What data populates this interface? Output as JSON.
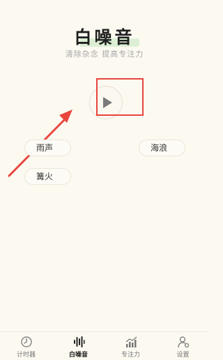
{
  "header": {
    "title": "白噪音",
    "subtitle": "清除杂念 提高专注力"
  },
  "player": {
    "play_icon": "play-icon"
  },
  "sounds": [
    {
      "label": "雨声"
    },
    {
      "label": "海浪"
    },
    {
      "label": "篝火"
    }
  ],
  "annotation": {
    "highlight_color": "#e8453c"
  },
  "tabbar": {
    "tabs": [
      {
        "label": "计时器",
        "icon": "clock-icon"
      },
      {
        "label": "白噪音",
        "icon": "waveform-icon",
        "active": true
      },
      {
        "label": "专注力",
        "icon": "chart-icon"
      },
      {
        "label": "设置",
        "icon": "user-settings-icon"
      }
    ]
  }
}
